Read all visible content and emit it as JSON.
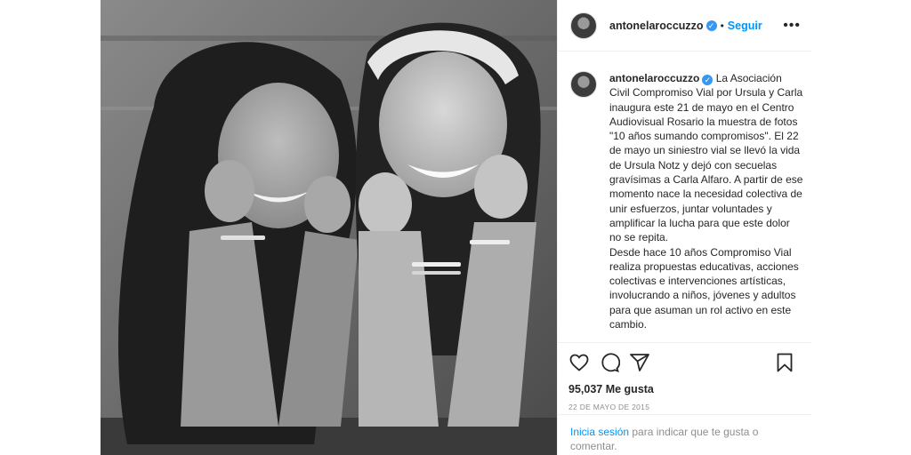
{
  "header": {
    "username": "antonelaroccuzzo",
    "separator": "•",
    "follow_label": "Seguir",
    "more_label": "•••"
  },
  "caption": {
    "username": "antonelaroccuzzo",
    "text": " La Asociación Civil Compromiso Vial por Ursula y Carla inaugura este 21 de mayo en el Centro Audiovisual Rosario la muestra de fotos \"10 años sumando compromisos\". El 22 de mayo un siniestro vial se llevó la vida de Ursula Notz y dejó con secuelas gravísimas a Carla Alfaro. A partir de ese momento nace la necesidad colectiva de unir esfuerzos, juntar voluntades y amplificar la lucha para que este dolor no se repita.\nDesde hace 10 años Compromiso Vial realiza propuestas educativas, acciones colectivas e intervenciones artísticas, involucrando a niños, jóvenes y adultos para que asuman un rol activo en este cambio."
  },
  "actions": {
    "icons": [
      "heart-icon",
      "comment-icon",
      "share-icon",
      "bookmark-icon"
    ],
    "likes": "95,037 Me gusta",
    "date": "22 DE MAYO DE 2015"
  },
  "login": {
    "link": "Inicia sesión",
    "rest": " para indicar que te gusta o comentar."
  },
  "colors": {
    "link_blue": "#0095f6",
    "verified_blue": "#3897f0",
    "muted": "#8e8e8e"
  }
}
